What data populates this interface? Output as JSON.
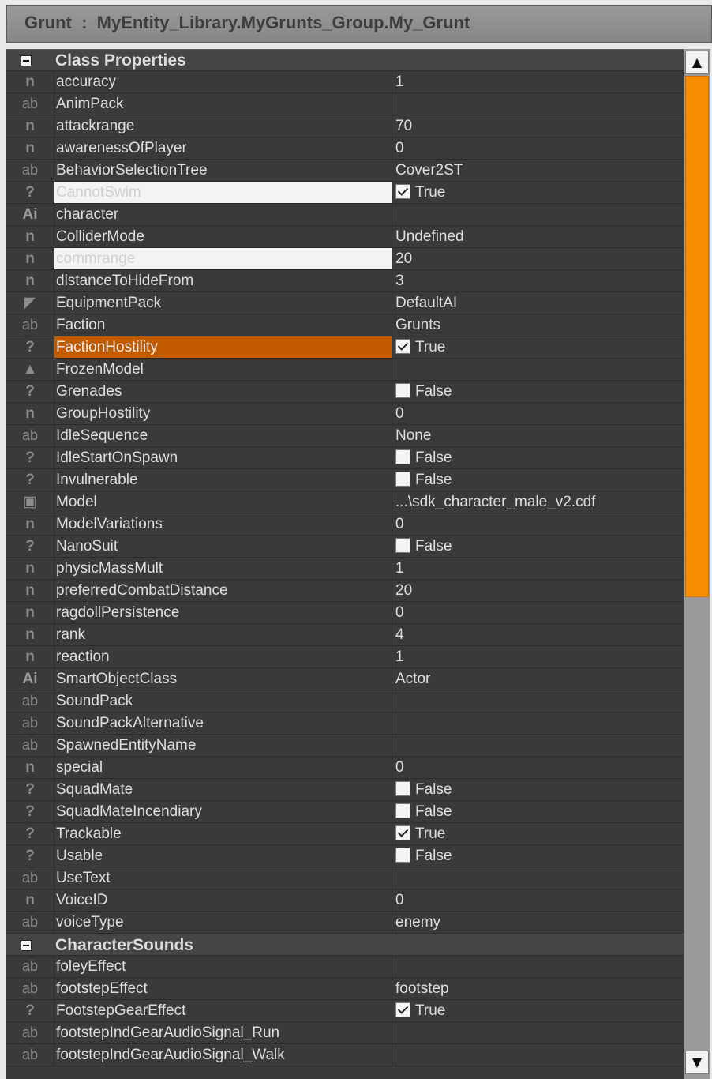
{
  "window": {
    "title": "Grunt  :  MyEntity_Library.MyGrunts_Group.My_Grunt"
  },
  "categories": [
    {
      "label": "Class Properties",
      "rows": [
        {
          "icon": "n",
          "name": "accuracy",
          "value": "1"
        },
        {
          "icon": "ab",
          "name": "AnimPack",
          "value": ""
        },
        {
          "icon": "n",
          "name": "attackrange",
          "value": "70"
        },
        {
          "icon": "n",
          "name": "awarenessOfPlayer",
          "value": "0"
        },
        {
          "icon": "ab",
          "name": "BehaviorSelectionTree",
          "value": "Cover2ST"
        },
        {
          "icon": "?",
          "name": "CannotSwim",
          "value": "True",
          "bool": true,
          "state": "disabled"
        },
        {
          "icon": "Ai",
          "name": "character",
          "value": ""
        },
        {
          "icon": "n",
          "name": "ColliderMode",
          "value": "Undefined"
        },
        {
          "icon": "n",
          "name": "commrange",
          "value": "20",
          "state": "disabled"
        },
        {
          "icon": "n",
          "name": "distanceToHideFrom",
          "value": "3"
        },
        {
          "icon": "gun",
          "name": "EquipmentPack",
          "value": "DefaultAI"
        },
        {
          "icon": "ab",
          "name": "Faction",
          "value": "Grunts"
        },
        {
          "icon": "?",
          "name": "FactionHostility",
          "value": "True",
          "bool": true,
          "state": "selected"
        },
        {
          "icon": "mesh",
          "name": "FrozenModel",
          "value": ""
        },
        {
          "icon": "?",
          "name": "Grenades",
          "value": "False",
          "bool": false
        },
        {
          "icon": "n",
          "name": "GroupHostility",
          "value": "0"
        },
        {
          "icon": "ab",
          "name": "IdleSequence",
          "value": "None"
        },
        {
          "icon": "?",
          "name": "IdleStartOnSpawn",
          "value": "False",
          "bool": false
        },
        {
          "icon": "?",
          "name": "Invulnerable",
          "value": "False",
          "bool": false
        },
        {
          "icon": "file",
          "name": "Model",
          "value": "...\\sdk_character_male_v2.cdf"
        },
        {
          "icon": "n",
          "name": "ModelVariations",
          "value": "0"
        },
        {
          "icon": "?",
          "name": "NanoSuit",
          "value": "False",
          "bool": false
        },
        {
          "icon": "n",
          "name": "physicMassMult",
          "value": "1"
        },
        {
          "icon": "n",
          "name": "preferredCombatDistance",
          "value": "20"
        },
        {
          "icon": "n",
          "name": "ragdollPersistence",
          "value": "0"
        },
        {
          "icon": "n",
          "name": "rank",
          "value": "4"
        },
        {
          "icon": "n",
          "name": "reaction",
          "value": "1"
        },
        {
          "icon": "Ai",
          "name": "SmartObjectClass",
          "value": "Actor"
        },
        {
          "icon": "ab",
          "name": "SoundPack",
          "value": ""
        },
        {
          "icon": "ab",
          "name": "SoundPackAlternative",
          "value": ""
        },
        {
          "icon": "ab",
          "name": "SpawnedEntityName",
          "value": ""
        },
        {
          "icon": "n",
          "name": "special",
          "value": "0"
        },
        {
          "icon": "?",
          "name": "SquadMate",
          "value": "False",
          "bool": false
        },
        {
          "icon": "?",
          "name": "SquadMateIncendiary",
          "value": "False",
          "bool": false
        },
        {
          "icon": "?",
          "name": "Trackable",
          "value": "True",
          "bool": true
        },
        {
          "icon": "?",
          "name": "Usable",
          "value": "False",
          "bool": false
        },
        {
          "icon": "ab",
          "name": "UseText",
          "value": ""
        },
        {
          "icon": "n",
          "name": "VoiceID",
          "value": "0"
        },
        {
          "icon": "ab",
          "name": "voiceType",
          "value": "enemy"
        }
      ]
    },
    {
      "label": "CharacterSounds",
      "rows": [
        {
          "icon": "ab",
          "name": "foleyEffect",
          "value": ""
        },
        {
          "icon": "ab",
          "name": "footstepEffect",
          "value": "footstep"
        },
        {
          "icon": "?",
          "name": "FootstepGearEffect",
          "value": "True",
          "bool": true
        },
        {
          "icon": "ab",
          "name": "footstepIndGearAudioSignal_Run",
          "value": ""
        },
        {
          "icon": "ab",
          "name": "footstepIndGearAudioSignal_Walk",
          "value": ""
        }
      ]
    }
  ],
  "colors": {
    "accent": "#f78c00",
    "selected_row": "#c25a00",
    "grid_bg": "#3a3a3a"
  }
}
